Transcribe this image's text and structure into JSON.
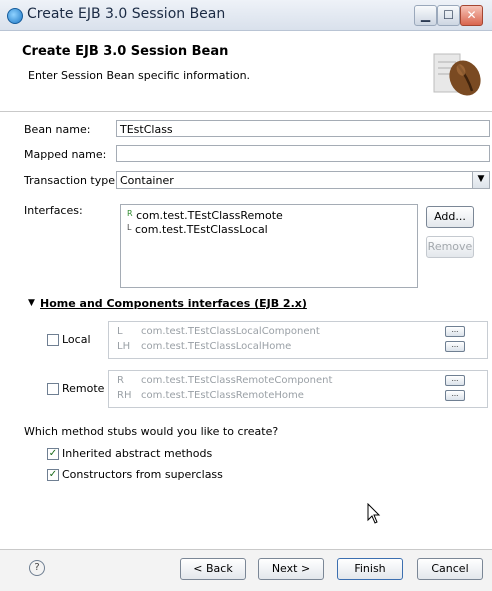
{
  "window": {
    "title": "Create EJB 3.0 Session Bean",
    "controls": [
      "minimize-icon",
      "maximize-icon",
      "close-icon"
    ]
  },
  "header": {
    "title": "Create EJB 3.0 Session Bean",
    "description": "Enter Session Bean specific information."
  },
  "form": {
    "bean_name_label": "Bean name:",
    "bean_name_value": "TEstClass",
    "mapped_name_label": "Mapped name:",
    "mapped_name_value": "",
    "transaction_type_label": "Transaction type:",
    "transaction_type_value": "Container",
    "interfaces_label": "Interfaces:",
    "interfaces": [
      {
        "prefix": "R",
        "value": "com.test.TEstClassRemote"
      },
      {
        "prefix": "L",
        "value": "com.test.TEstClassLocal"
      }
    ],
    "add_button": "Add...",
    "remove_button": "Remove"
  },
  "home_section": {
    "title": "Home and Components interfaces (EJB 2.x)",
    "local": {
      "label": "Local",
      "checked": false,
      "rows": [
        {
          "prefix": "L",
          "value": "com.test.TEstClassLocalComponent"
        },
        {
          "prefix": "LH",
          "value": "com.test.TEstClassLocalHome"
        }
      ]
    },
    "remote": {
      "label": "Remote",
      "checked": false,
      "rows": [
        {
          "prefix": "R",
          "value": "com.test.TEstClassRemoteComponent"
        },
        {
          "prefix": "RH",
          "value": "com.test.TEstClassRemoteHome"
        }
      ]
    },
    "browse_button_label": "..."
  },
  "stubs": {
    "question": "Which method stubs would you like to create?",
    "inherited_label": "Inherited abstract methods",
    "inherited_checked": true,
    "constructors_label": "Constructors from superclass",
    "constructors_checked": true
  },
  "footer": {
    "help_icon": "help-icon",
    "back_button": "< Back",
    "next_button": "Next >",
    "finish_button": "Finish",
    "cancel_button": "Cancel"
  }
}
